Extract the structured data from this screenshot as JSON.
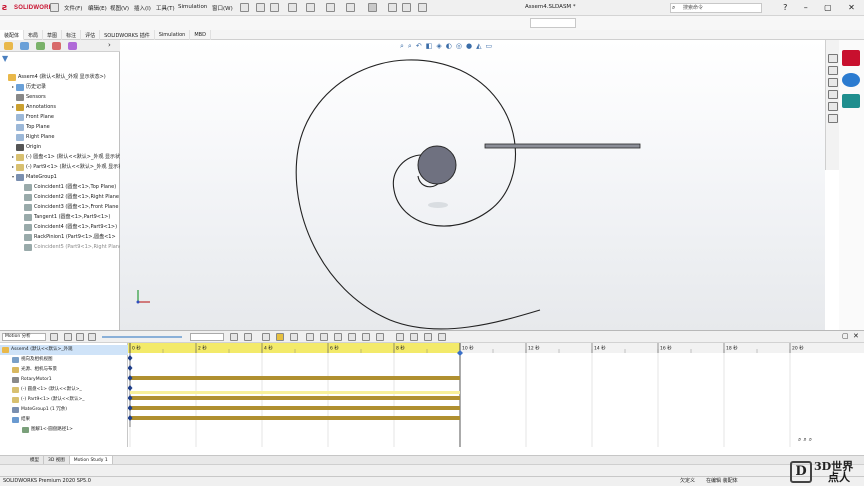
{
  "titlebar": {
    "app_name": "SOLIDWORKS",
    "menus": [
      "文件(F)",
      "编辑(E)",
      "视图(V)",
      "插入(I)",
      "工具(T)",
      "Simulation",
      "窗口(W)"
    ],
    "filename": "Assem4.SLDASM *",
    "search_placeholder": "搜索命令",
    "win_buttons": [
      "?",
      "–",
      "▢",
      "✕"
    ]
  },
  "command_tabs": [
    "装配体",
    "布局",
    "草图",
    "标注",
    "评估",
    "SOLIDWORKS 插件",
    "Simulation",
    "MBD"
  ],
  "feature_tree": {
    "items": [
      {
        "label": "Assem4 (默认<默认_外观 显示状态>)",
        "indent": 0,
        "icon": "assembly-icon",
        "arrow": ""
      },
      {
        "label": "历史记录",
        "indent": 1,
        "icon": "history-icon",
        "arrow": "▸"
      },
      {
        "label": "Sensors",
        "indent": 1,
        "icon": "sensor-icon",
        "arrow": ""
      },
      {
        "label": "Annotations",
        "indent": 1,
        "icon": "annotation-icon",
        "arrow": "▸"
      },
      {
        "label": "Front Plane",
        "indent": 1,
        "icon": "plane-icon",
        "arrow": ""
      },
      {
        "label": "Top Plane",
        "indent": 1,
        "icon": "plane-icon",
        "arrow": ""
      },
      {
        "label": "Right Plane",
        "indent": 1,
        "icon": "plane-icon",
        "arrow": ""
      },
      {
        "label": "Origin",
        "indent": 1,
        "icon": "origin-icon",
        "arrow": ""
      },
      {
        "label": "(-) 圆盘<1> (默认<<默认>_外观 显示状",
        "indent": 1,
        "icon": "part-icon",
        "arrow": "▸"
      },
      {
        "label": "(-) Part9<1> (默认<<默认>_外观 显示状",
        "indent": 1,
        "icon": "part-icon",
        "arrow": "▸"
      },
      {
        "label": "MateGroup1",
        "indent": 1,
        "icon": "mate-icon",
        "arrow": "▾"
      },
      {
        "label": "Coincident1 (圆盘<1>,Top Plane)",
        "indent": 2,
        "icon": "coincident-icon",
        "arrow": ""
      },
      {
        "label": "Coincident2 (圆盘<1>,Right Plane",
        "indent": 2,
        "icon": "coincident-icon",
        "arrow": ""
      },
      {
        "label": "Coincident3 (圆盘<1>,Front Plane",
        "indent": 2,
        "icon": "coincident-icon",
        "arrow": ""
      },
      {
        "label": "Tangent1 (圆盘<1>,Part9<1>)",
        "indent": 2,
        "icon": "tangent-icon",
        "arrow": ""
      },
      {
        "label": "Coincident4 (圆盘<1>,Part9<1>)",
        "indent": 2,
        "icon": "coincident-icon",
        "arrow": ""
      },
      {
        "label": "RackPinion1 (Part9<1>,圆盘<1>",
        "indent": 2,
        "icon": "rackpinion-icon",
        "arrow": ""
      },
      {
        "label": "Coincident5 (Part9<1>,Right Plane",
        "indent": 2,
        "icon": "coincident-icon",
        "arrow": "",
        "faded": true
      }
    ]
  },
  "motion": {
    "study_type": "Motion 分析",
    "time_field": "",
    "time_labels": [
      "0 秒",
      "2 秒",
      "4 秒",
      "6 秒",
      "8 秒",
      "10 秒",
      "12 秒",
      "14 秒",
      "16 秒",
      "18 秒",
      "20 秒"
    ],
    "tree": [
      {
        "label": "Assem4 (默认<<默认>_外观",
        "indent": 0,
        "sel": true
      },
      {
        "label": "视向及相机视图",
        "indent": 1
      },
      {
        "label": "光源、相机与布景",
        "indent": 1
      },
      {
        "label": "RotaryMotor1",
        "indent": 1
      },
      {
        "label": "(-) 圆盘<1> (默认<<默认>_",
        "indent": 1
      },
      {
        "label": "(-) Part9<1> (默认<<默认>_",
        "indent": 1
      },
      {
        "label": "MateGroup1 (1 冗余)",
        "indent": 1
      },
      {
        "label": "结果",
        "indent": 1
      },
      {
        "label": "图解1<-圆盘路径1>",
        "indent": 2
      }
    ]
  },
  "bottom_tabs": [
    "模型",
    "3D 视图",
    "Motion Study 1"
  ],
  "status": {
    "left": "SOLIDWORKS Premium 2020 SP5.0",
    "mid1": "欠定义",
    "mid2": "在编辑 装配体"
  },
  "watermark": {
    "mark": "D",
    "line1": "3D世界",
    "line2": "点人"
  }
}
